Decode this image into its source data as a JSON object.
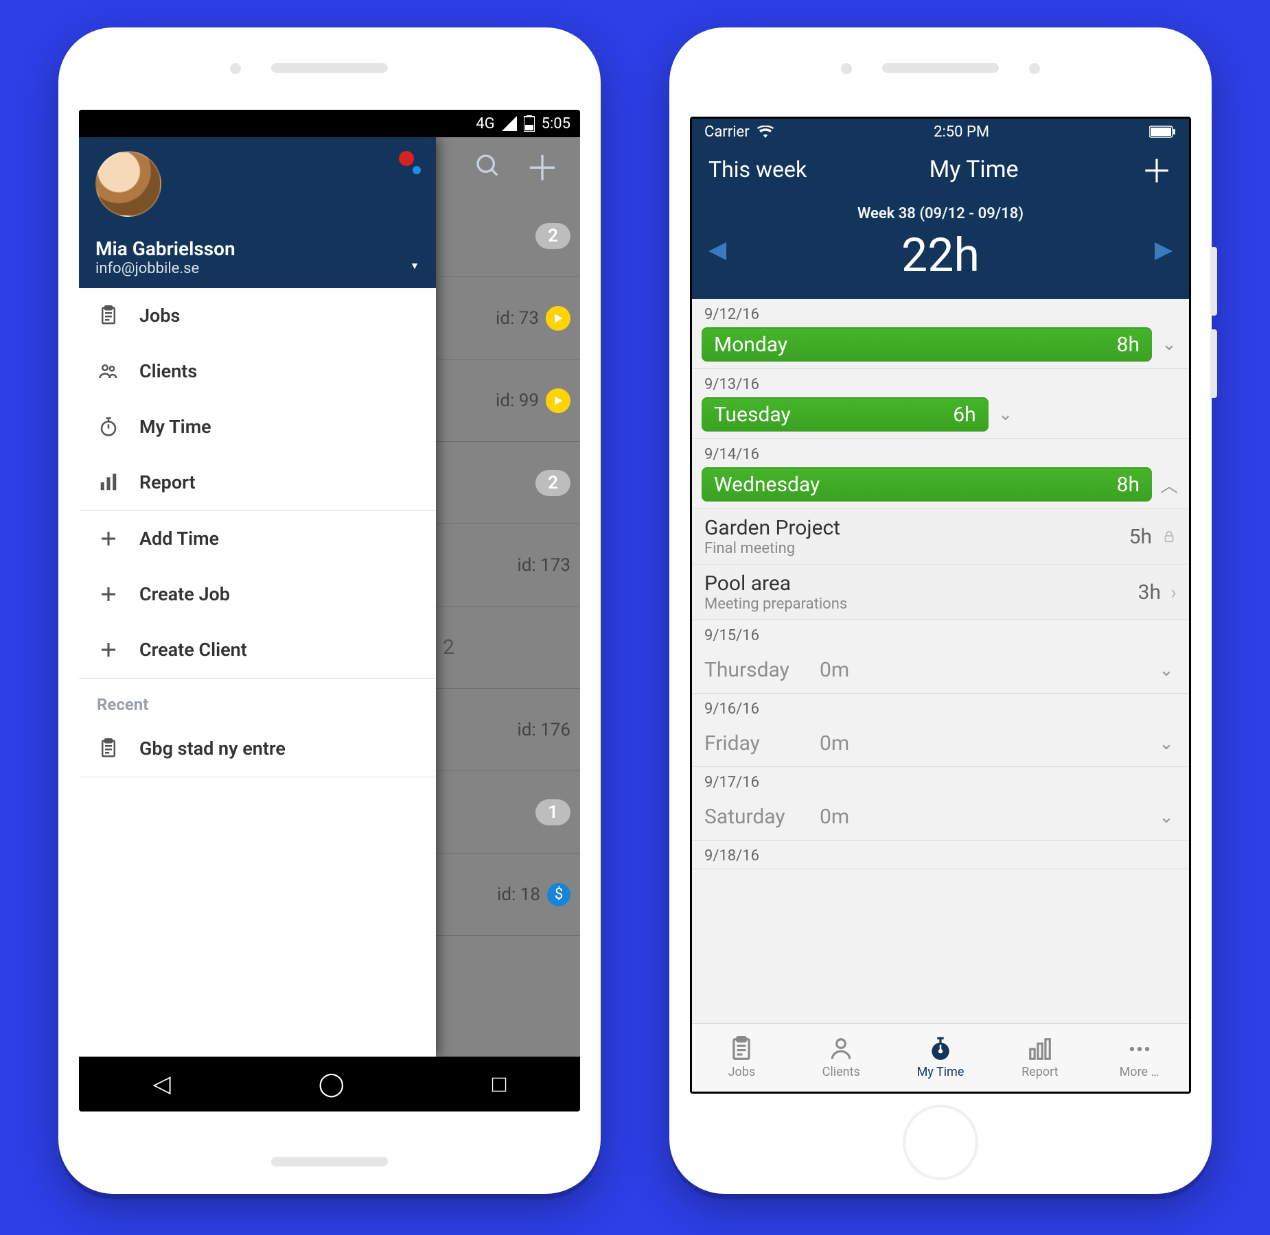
{
  "android": {
    "status": {
      "network": "4G",
      "time": "5:05"
    },
    "drawer": {
      "user": {
        "name": "Mia  Gabrielsson",
        "email": "info@jobbile.se"
      },
      "menu": [
        {
          "icon": "clipboard",
          "label": "Jobs"
        },
        {
          "icon": "people",
          "label": "Clients"
        },
        {
          "icon": "stopwatch",
          "label": "My Time"
        },
        {
          "icon": "bars",
          "label": "Report"
        }
      ],
      "actions": [
        {
          "icon": "plus",
          "label": "Add Time"
        },
        {
          "icon": "plus",
          "label": "Create Job"
        },
        {
          "icon": "plus",
          "label": "Create Client"
        }
      ],
      "recent_header": "Recent",
      "recent": [
        {
          "icon": "clipboard",
          "label": "Gbg stad ny entre"
        }
      ]
    },
    "behind": {
      "rows": [
        {
          "type": "pill",
          "text": "2"
        },
        {
          "type": "id_play",
          "text": "id: 73"
        },
        {
          "type": "id_play",
          "text": "id: 99"
        },
        {
          "type": "pill",
          "text": "2"
        },
        {
          "type": "id",
          "text": "id: 173"
        },
        {
          "type": "section",
          "text": "2"
        },
        {
          "type": "id",
          "text": "id: 176"
        },
        {
          "type": "pill",
          "text": "1"
        },
        {
          "type": "id_dollar",
          "text": "id: 18"
        }
      ]
    }
  },
  "ios": {
    "status": {
      "carrier": "Carrier",
      "time": "2:50 PM"
    },
    "header": {
      "left": "This week",
      "title": "My Time"
    },
    "summary": {
      "week_label": "Week 38 (09/12 - 09/18)",
      "total": "22h"
    },
    "days": [
      {
        "date": "9/12/16",
        "name": "Monday",
        "hours": "8h",
        "width": "full",
        "expanded": false
      },
      {
        "date": "9/13/16",
        "name": "Tuesday",
        "hours": "6h",
        "width": "small",
        "expanded": false
      },
      {
        "date": "9/14/16",
        "name": "Wednesday",
        "hours": "8h",
        "width": "full",
        "expanded": true,
        "entries": [
          {
            "title": "Garden Project",
            "sub": "Final meeting",
            "hrs": "5h",
            "right": "lock"
          },
          {
            "title": "Pool area",
            "sub": "Meeting preparations",
            "hrs": "3h",
            "right": "chev"
          }
        ]
      },
      {
        "date": "9/15/16",
        "name": "Thursday",
        "hours": "0m",
        "empty": true
      },
      {
        "date": "9/16/16",
        "name": "Friday",
        "hours": "0m",
        "empty": true
      },
      {
        "date": "9/17/16",
        "name": "Saturday",
        "hours": "0m",
        "empty": true
      },
      {
        "date": "9/18/16",
        "name": "",
        "hours": "",
        "cut": true
      }
    ],
    "tabs": [
      {
        "icon": "clipboard",
        "label": "Jobs"
      },
      {
        "icon": "person",
        "label": "Clients"
      },
      {
        "icon": "stopwatch",
        "label": "My Time",
        "active": true
      },
      {
        "icon": "bars",
        "label": "Report"
      },
      {
        "icon": "dots",
        "label": "More …"
      }
    ]
  }
}
